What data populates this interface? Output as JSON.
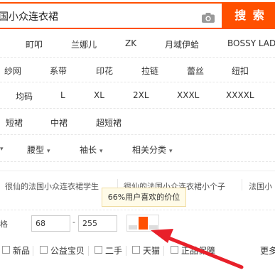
{
  "search": {
    "query": "国小众连衣裙",
    "button_label": "搜 索"
  },
  "brands": [
    "町叩",
    "兰娜儿",
    "ZK",
    "月域伊蛤",
    "BOSSY LAD"
  ],
  "styles": [
    "纱网",
    "系带",
    "印花",
    "拉链",
    "蕾丝",
    "纽扣"
  ],
  "sizes": [
    "均码",
    "L",
    "XL",
    "2XL",
    "XXXL",
    "XXXXL"
  ],
  "lengths": [
    "短裙",
    "中裙",
    "超短裙"
  ],
  "dropdowns": [
    "腰型",
    "袖长",
    "相关分类"
  ],
  "related_tags": [
    "很仙的法国小众连衣裙学生",
    "很仙的法国小众连衣裙小个子",
    "法国小"
  ],
  "tooltip": "66%用户喜欢的价位",
  "price": {
    "min": "68",
    "max": "255",
    "dash": "-",
    "label_fragment": "格"
  },
  "filters": [
    "新品",
    "公益宝贝",
    "二手",
    "天猫",
    "正品保障"
  ],
  "more": "更多",
  "colors": {
    "accent": "#ff5000",
    "arrow": "#e8202a"
  }
}
